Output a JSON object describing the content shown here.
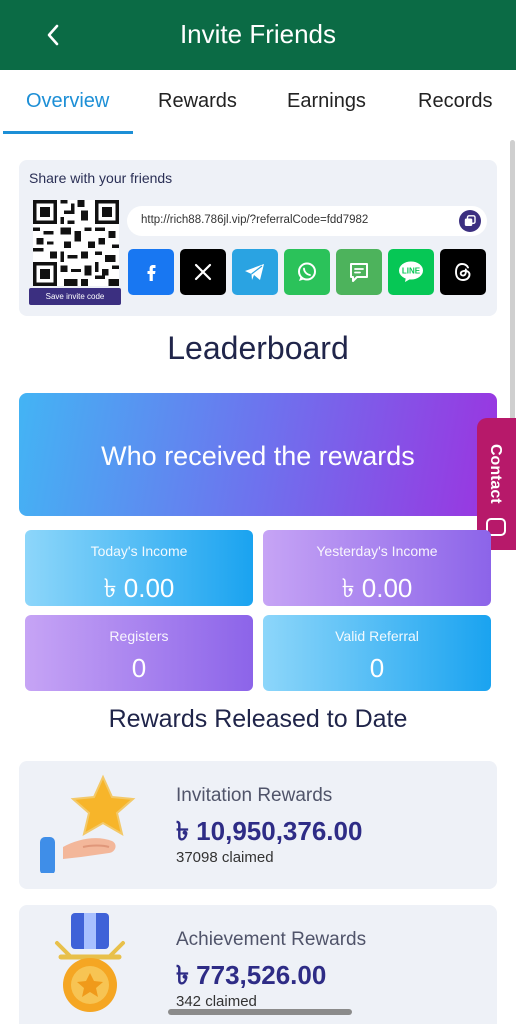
{
  "header": {
    "title": "Invite Friends"
  },
  "tabs": [
    {
      "label": "Overview"
    },
    {
      "label": "Rewards"
    },
    {
      "label": "Earnings"
    },
    {
      "label": "Records"
    }
  ],
  "share": {
    "title": "Share with your friends",
    "save_code_label": "Save invite code",
    "link": "http://rich88.786jl.vip/?referralCode=fdd7982",
    "socials": [
      "facebook",
      "x",
      "telegram",
      "whatsapp",
      "sms",
      "line",
      "threads"
    ],
    "line_label": "LINE"
  },
  "leaderboard": {
    "title": "Leaderboard"
  },
  "banner": {
    "text": "Who received the rewards"
  },
  "contact": {
    "label": "Contact"
  },
  "stats": {
    "today": {
      "label": "Today's Income",
      "value": "৳ 0.00"
    },
    "yesterday": {
      "label": "Yesterday's Income",
      "value": "৳ 0.00"
    },
    "registers": {
      "label": "Registers",
      "value": "0"
    },
    "valid_referral": {
      "label": "Valid Referral",
      "value": "0"
    }
  },
  "released": {
    "title": "Rewards Released to Date",
    "items": [
      {
        "name": "Invitation Rewards",
        "amount": "৳ 10,950,376.00",
        "claimed": "37098 claimed"
      },
      {
        "name": "Achievement Rewards",
        "amount": "৳ 773,526.00",
        "claimed": "342 claimed"
      }
    ]
  },
  "colors": {
    "header_bg": "#0b6b45",
    "tab_active": "#1d8fd6",
    "accent_purple": "#3b2f80",
    "contact_bg": "#b7196a"
  }
}
